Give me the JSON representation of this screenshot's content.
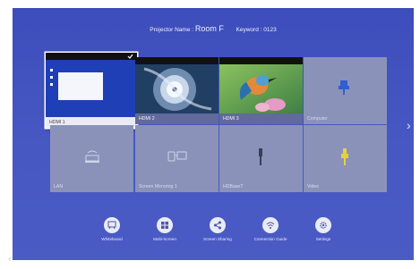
{
  "header": {
    "projector_prefix": "Projector Name : ",
    "projector_name": "Room F",
    "keyword_prefix": "Keyword : ",
    "keyword": "0123"
  },
  "tiles": [
    {
      "label": "HDMI 1",
      "selected": true
    },
    {
      "label": "HDMI 2"
    },
    {
      "label": "HDMI 3"
    },
    {
      "label": "Computer",
      "icon": "usb-plug-icon"
    },
    {
      "label": "LAN",
      "icon": "lan-pc-icon"
    },
    {
      "label": "Screen Mirroring 1",
      "icon": "screen-mirroring-icon"
    },
    {
      "label": "HDBaseT",
      "icon": "hdbaset-plug-icon"
    },
    {
      "label": "Video",
      "icon": "video-plug-icon"
    }
  ],
  "bottom": [
    {
      "label": "Whiteboard",
      "icon": "whiteboard-icon"
    },
    {
      "label": "Multi-Screen",
      "icon": "multi-screen-icon"
    },
    {
      "label": "Screen Sharing",
      "icon": "share-icon"
    },
    {
      "label": "Connection Guide",
      "icon": "wifi-icon"
    },
    {
      "label": "Settings",
      "icon": "gear-icon"
    }
  ],
  "colors": {
    "background": "#4456c1",
    "tile": "#8a92ba",
    "accent_blue": "#2f5fd0",
    "accent_yellow": "#e8d23a"
  }
}
